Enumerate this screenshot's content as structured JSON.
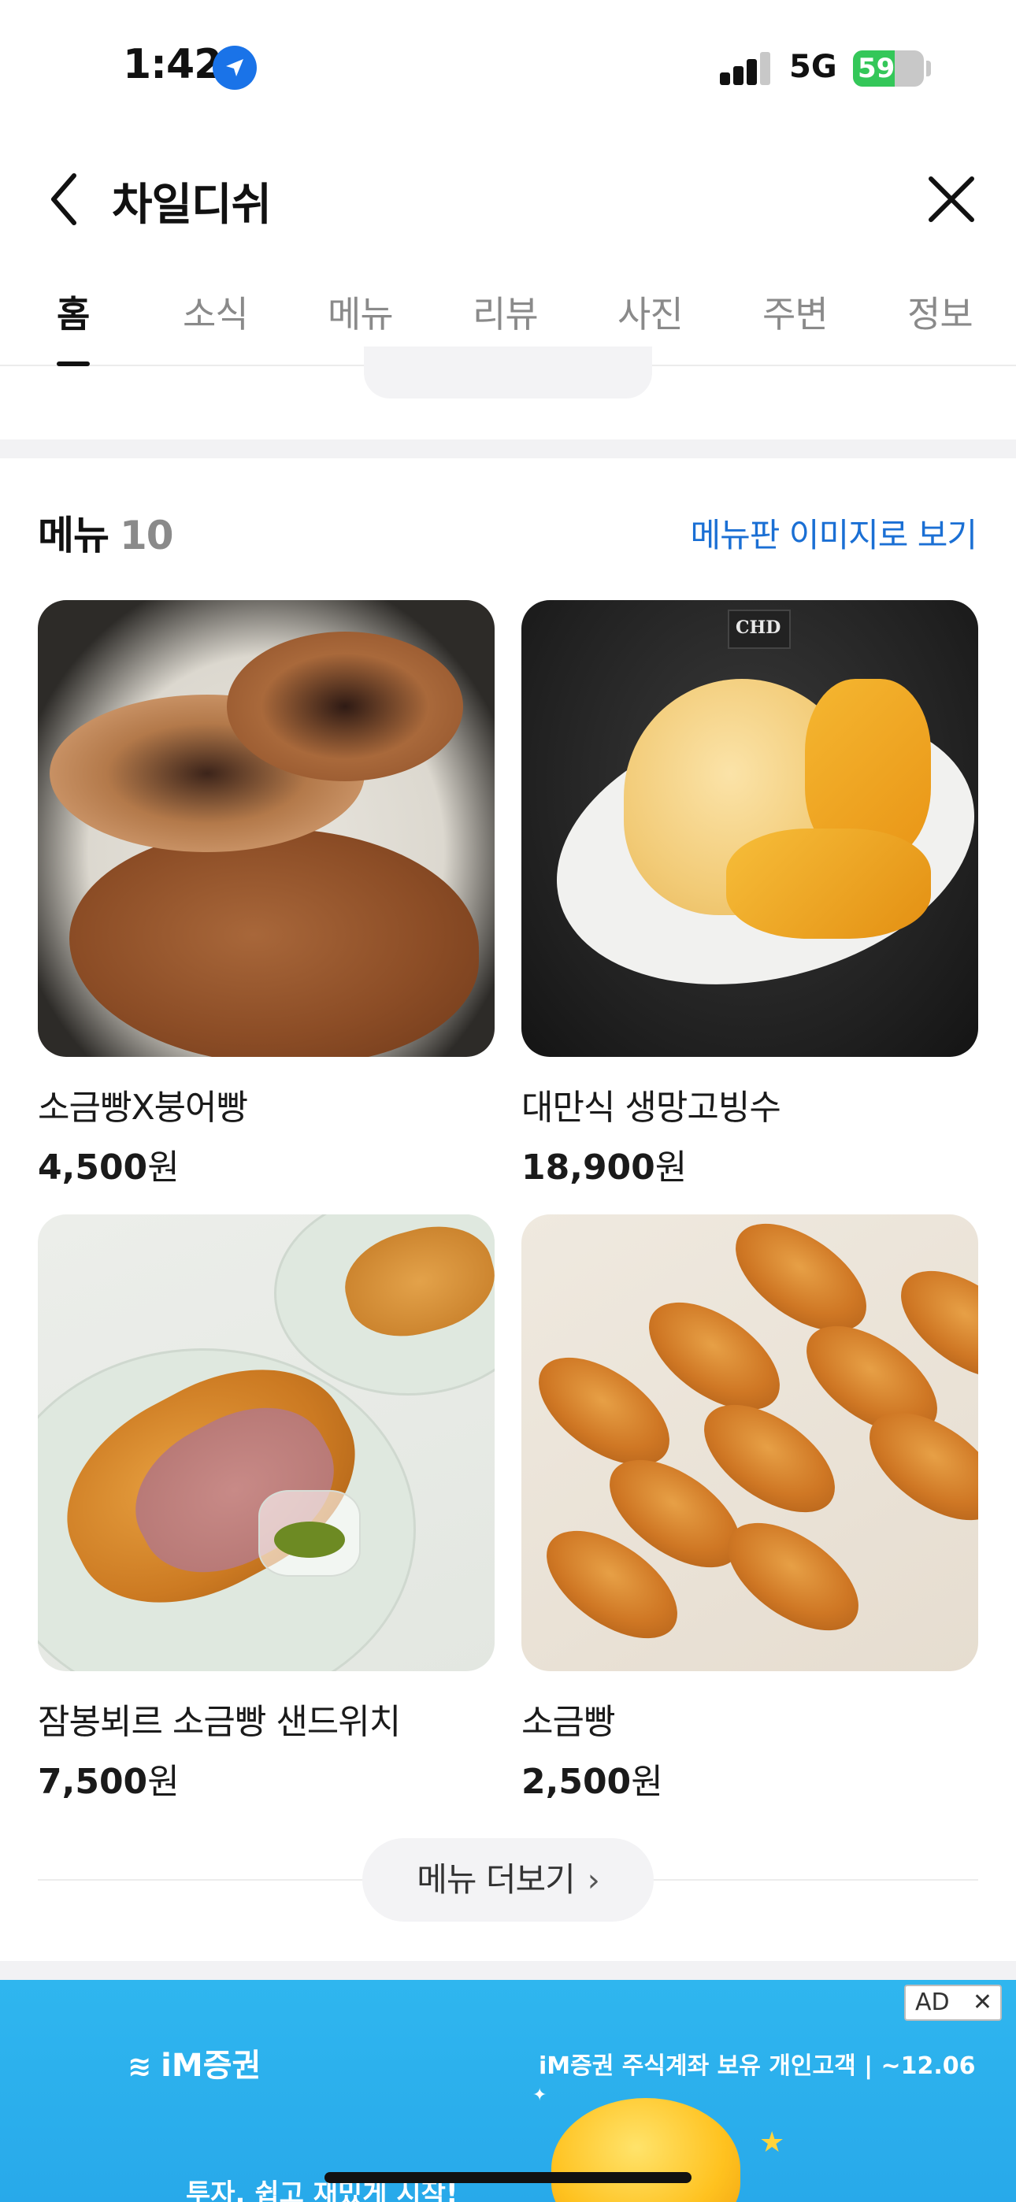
{
  "status_bar": {
    "time": "1:42",
    "network": "5G",
    "battery": "59"
  },
  "header": {
    "title": "차일디쉬"
  },
  "tabs": [
    {
      "label": "홈",
      "active": true
    },
    {
      "label": "소식"
    },
    {
      "label": "메뉴"
    },
    {
      "label": "리뷰"
    },
    {
      "label": "사진"
    },
    {
      "label": "주변"
    },
    {
      "label": "정보"
    }
  ],
  "menu_section": {
    "heading": "메뉴",
    "count": "10",
    "board_link": "메뉴판 이미지로 보기",
    "items": [
      {
        "name": "소금빵X붕어빵",
        "price": "4,500",
        "unit": "원"
      },
      {
        "name": "대만식 생망고빙수",
        "price": "18,900",
        "unit": "원"
      },
      {
        "name": "잠봉뵈르 소금빵 샌드위치",
        "price": "7,500",
        "unit": "원"
      },
      {
        "name": "소금빵",
        "price": "2,500",
        "unit": "원"
      }
    ],
    "more_button": "메뉴 더보기"
  },
  "ad": {
    "badge": "AD",
    "logo": "iM증권",
    "headline": "iM증권 주식계좌 보유 개인고객 | ~12.06",
    "subline": "투자, 쉽고 재밌게 시작!",
    "image_text": "CHD"
  },
  "colors": {
    "link": "#1a6fd4",
    "accent_location": "#1a73e8",
    "battery_green": "#34c759",
    "ad_bg": "#2fb6ef"
  },
  "icons": [
    "location-arrow-icon",
    "signal-icon",
    "battery-icon",
    "back-arrow-icon",
    "close-icon",
    "chevron-right-icon"
  ]
}
